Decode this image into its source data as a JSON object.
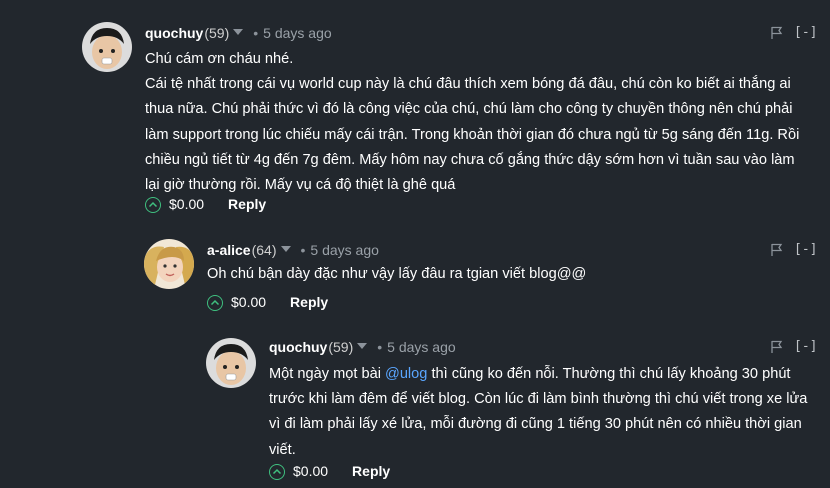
{
  "comments": [
    {
      "author": "quochuy",
      "reputation": "(59)",
      "time": "5 days ago",
      "collapse_label": "[-]",
      "body_lines": [
        "Chú cám ơn cháu nhé.",
        "Cái tệ nhất trong cái vụ world cup này là chú đâu thích xem bóng đá đâu, chú còn ko biết ai thắng ai thua nữa. Chú phải thức vì đó là công việc của chú, chú làm cho công ty chuyền thông nên chú phải làm support trong lúc chiếu mấy cái trận. Trong khoản thời gian đó chưa ngủ từ 5g sáng đến 11g. Rồi chiều ngủ tiết từ 4g đến 7g đêm. Mấy hôm nay chưa cố gắng thức dậy sớm hơn vì tuần sau vào làm lại giờ thường rồi. Mấy vụ cá độ thiệt là ghê quá"
      ],
      "payout": "$0.00",
      "reply_label": "Reply"
    },
    {
      "author": "a-alice",
      "reputation": "(64)",
      "time": "5 days ago",
      "collapse_label": "[-]",
      "body": "Oh chú bận dày đặc như vậy lấy đâu ra tgian viết blog@@",
      "payout": "$0.00",
      "reply_label": "Reply"
    },
    {
      "author": "quochuy",
      "reputation": "(59)",
      "time": "5 days ago",
      "collapse_label": "[-]",
      "body_before_mention": "Một ngày mọt bài ",
      "mention": "@ulog",
      "body_after_mention": " thì cũng ko đến nỗi. Thường thì chú lấy khoảng 30 phút trước khi làm đêm để viết blog. Còn lúc đi làm bình thường thì chú viết trong xe lửa vì đi làm phải lấy xé lửa, mỗi đường đi cũng 1 tiếng 30 phút nên có nhiều thời gian viết.",
      "payout": "$0.00",
      "reply_label": "Reply"
    }
  ],
  "colors": {
    "background": "#22272d",
    "mention": "#5aa6ff",
    "vote": "#3fbf7f"
  }
}
